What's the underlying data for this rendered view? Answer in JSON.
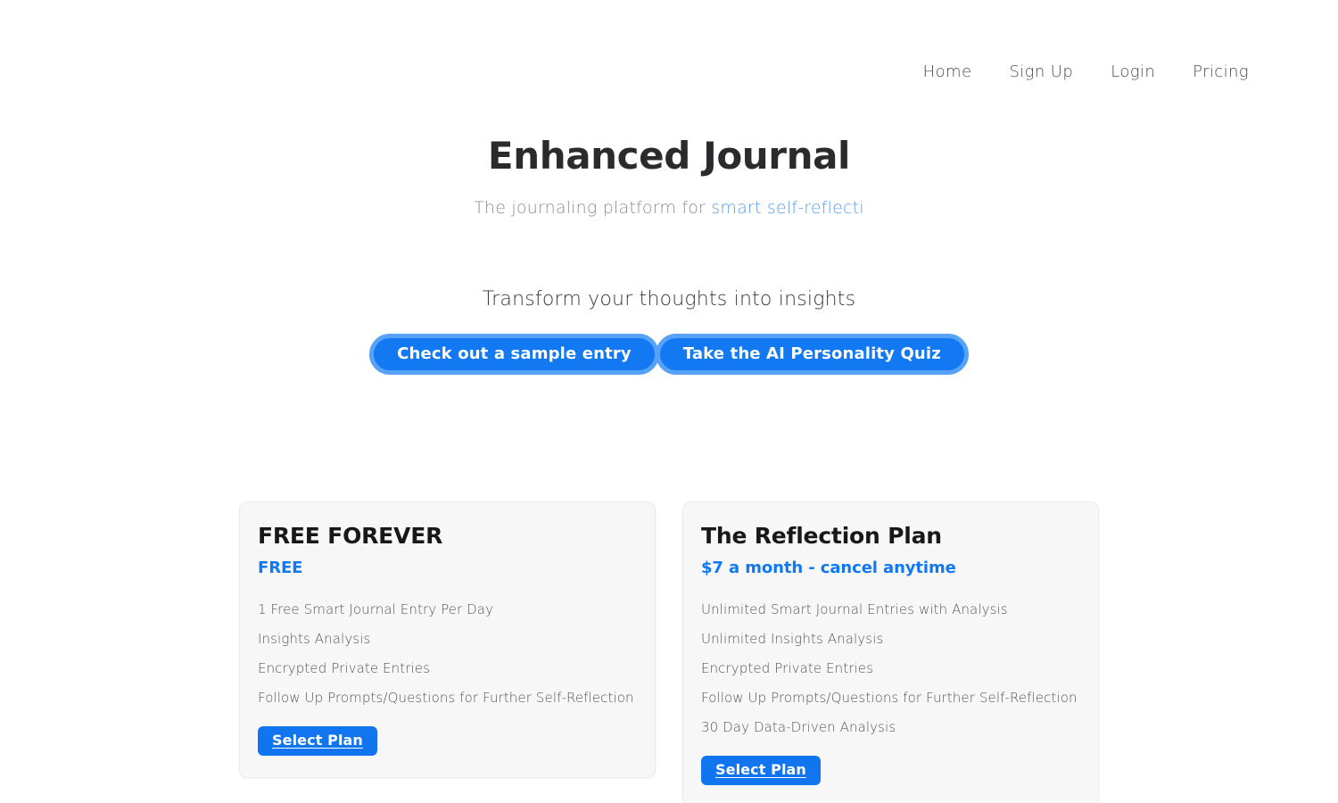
{
  "nav": {
    "items": [
      {
        "label": "Home"
      },
      {
        "label": "Sign Up"
      },
      {
        "label": "Login"
      },
      {
        "label": "Pricing"
      }
    ]
  },
  "hero": {
    "title": "Enhanced Journal",
    "subtitle_static": "The journaling platform for ",
    "subtitle_accent": "smart self-reflecti",
    "accent_color": "#5b9ceb"
  },
  "cta": {
    "tagline": "Transform your thoughts into insights",
    "primary_button": "Check out a sample entry",
    "secondary_button": "Take the AI Personality Quiz",
    "button_fill": "#1279f2",
    "button_ring": "#57a1f7"
  },
  "pricing": {
    "plans": [
      {
        "title": "FREE FOREVER",
        "price": "FREE",
        "features": [
          "1 Free Smart Journal Entry Per Day",
          "Insights Analysis",
          "Encrypted Private Entries",
          "Follow Up Prompts/Questions for Further Self-Reflection"
        ],
        "cta": "Select Plan"
      },
      {
        "title": "The Reflection Plan",
        "price": "$7 a month - cancel anytime",
        "features": [
          "Unlimited Smart Journal Entries with Analysis",
          "Unlimited Insights Analysis",
          "Encrypted Private Entries",
          "Follow Up Prompts/Questions for Further Self-Reflection",
          "30 Day Data-Driven Analysis"
        ],
        "cta": "Select Plan"
      }
    ],
    "price_color": "#1079f2",
    "card_background": "#f7f7f8"
  }
}
